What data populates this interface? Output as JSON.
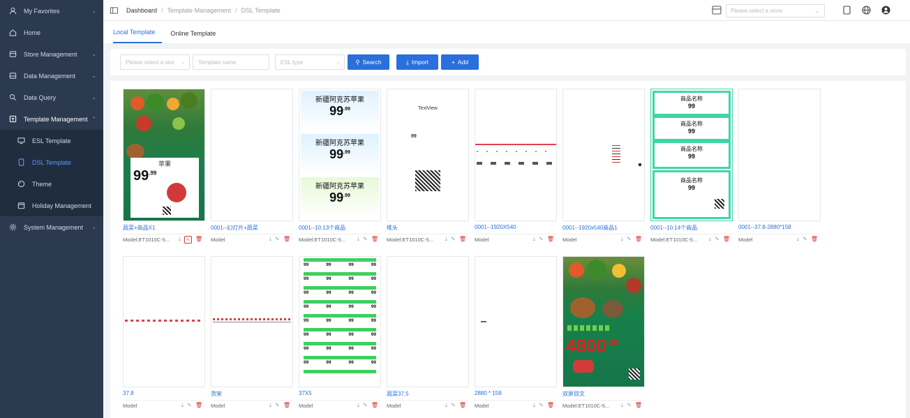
{
  "sidebar": {
    "items": [
      {
        "label": "My Favorites",
        "icon": "person-icon"
      },
      {
        "label": "Home",
        "icon": "home-icon"
      },
      {
        "label": "Store Management",
        "icon": "store-icon"
      },
      {
        "label": "Data Management",
        "icon": "database-icon"
      },
      {
        "label": "Data Query",
        "icon": "search-icon"
      },
      {
        "label": "Template Management",
        "icon": "template-icon"
      }
    ],
    "sub_items": [
      {
        "label": "ESL Template",
        "icon": "monitor-icon"
      },
      {
        "label": "DSL Template",
        "icon": "tablet-icon"
      },
      {
        "label": "Theme",
        "icon": "palette-icon"
      },
      {
        "label": "Holiday Management",
        "icon": "calendar-icon"
      }
    ],
    "system": {
      "label": "System Management",
      "icon": "gear-icon"
    }
  },
  "breadcrumb": {
    "home": "Dashboard",
    "level1": "Template Management",
    "level2": "DSL Template"
  },
  "store_select": {
    "placeholder": "Please select a store"
  },
  "tabs": {
    "local": "Local Template",
    "online": "Online Template"
  },
  "toolbar": {
    "store_placeholder": "Please select a stor",
    "name_placeholder": "Template name",
    "type_placeholder": "ESL type",
    "search": "Search",
    "import": "Import",
    "add": "Add"
  },
  "thumb_text": {
    "apple": "苹果",
    "price": "99",
    "price_sup": ".99",
    "xinjiang": "新疆阿克苏苹果",
    "textview": "TextView",
    "product": "商品名称",
    "big_price": "4800",
    "big_price_sup": ".00",
    "small_price": "99"
  },
  "templates": [
    {
      "name": "蔬菜+商品X1",
      "model": "Model:ET1010C-5..."
    },
    {
      "name": "0001--幻灯片+蔬菜",
      "model": "Model"
    },
    {
      "name": "0001--10.13个商品",
      "model": "Model:ET1010C-5..."
    },
    {
      "name": "堆头",
      "model": "Model:ET1010C-5..."
    },
    {
      "name": "0001--1920X540",
      "model": "Model"
    },
    {
      "name": "0001--1920x540商品1",
      "model": "Model"
    },
    {
      "name": "0001--10.14个商品",
      "model": "Model:ET1010C-5..."
    },
    {
      "name": "0001--37.8-2880*158",
      "model": "Model"
    },
    {
      "name": "37.8",
      "model": "Model"
    },
    {
      "name": "货架",
      "model": "Model"
    },
    {
      "name": "37X5",
      "model": "Model"
    },
    {
      "name": "蔬菜37.5",
      "model": "Model"
    },
    {
      "name": "2880 * 158",
      "model": "Model"
    },
    {
      "name": "双屏目文",
      "model": "Model:ET1010C-5..."
    }
  ],
  "colors": {
    "sidebar_bg": "#2b3a4f",
    "accent": "#2a6fdb",
    "delete": "#e03030",
    "teal": "#3fd6a7"
  }
}
